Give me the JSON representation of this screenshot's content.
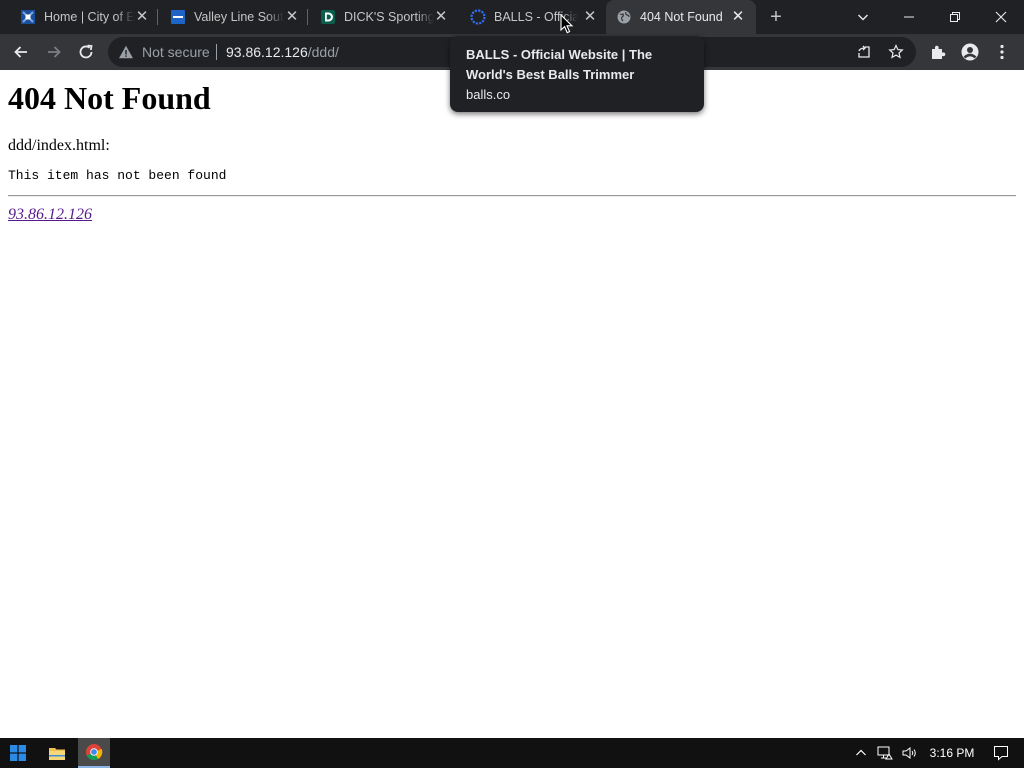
{
  "tabs": [
    {
      "title": "Home | City of E",
      "favicon": "city-of-edmonton-favicon-icon",
      "accent": "#1a4f9e"
    },
    {
      "title": "Valley Line Sout",
      "favicon": "valley-line-favicon-icon",
      "accent": "#1e63c6"
    },
    {
      "title": "DICK'S Sporting",
      "favicon": "dicks-sporting-favicon-icon",
      "accent": "#0b5e4e"
    },
    {
      "title": "BALLS - Official",
      "favicon": "balls-favicon-icon",
      "accent": "#2f6ff2"
    },
    {
      "title": "404 Not Found",
      "favicon": "globe-icon",
      "accent": "#9aa0a6"
    }
  ],
  "toolbar": {
    "security_label": "Not secure",
    "url_host": "93.86.12.126",
    "url_path": "/ddd/"
  },
  "hovercard": {
    "title": "BALLS - Official Website | The World's Best Balls Trimmer",
    "domain": "balls.co"
  },
  "page": {
    "heading": "404 Not Found",
    "file": "ddd/index.html:",
    "message": "This item has not been found",
    "address": "93.86.12.126"
  },
  "taskbar": {
    "time": "3:16 PM"
  },
  "colors": {
    "tabstrip_bg": "#202124",
    "toolbar_bg": "#35363a",
    "visited_link": "#551a8b"
  }
}
